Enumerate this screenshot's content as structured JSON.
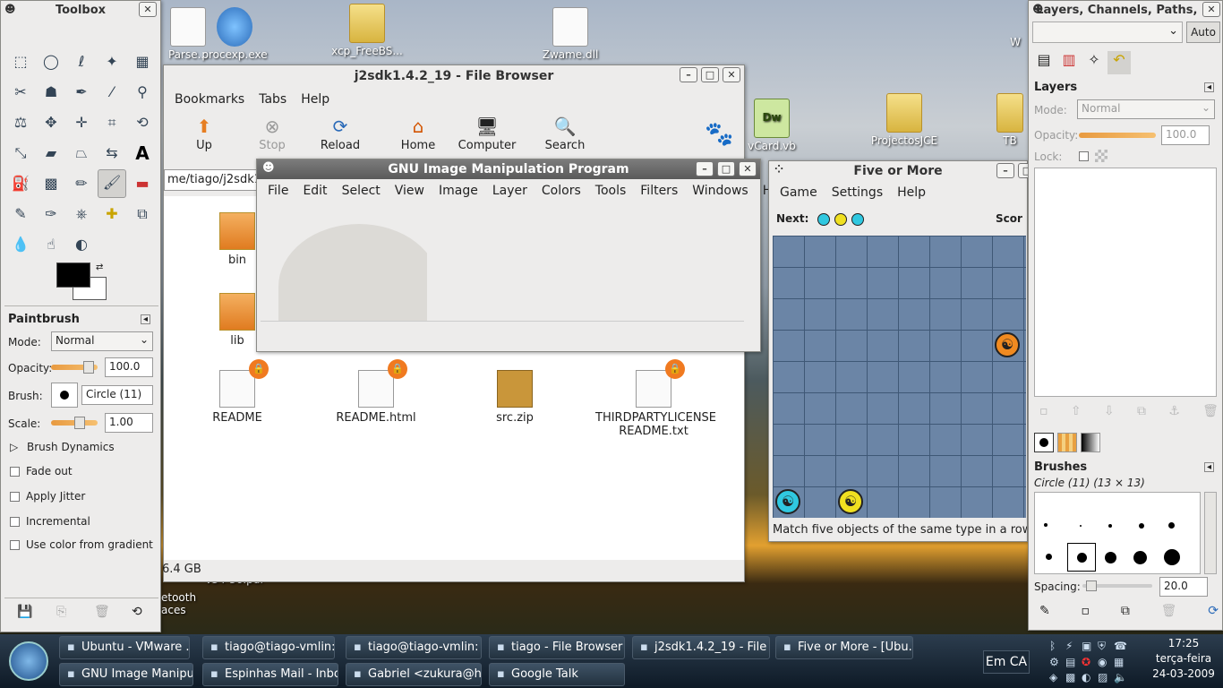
{
  "desktop": {
    "icons": [
      {
        "label": "Parse...",
        "kind": "file"
      },
      {
        "label": "procexp.exe",
        "kind": "app"
      },
      {
        "label": "xcp_FreeBS...",
        "kind": "folder"
      },
      {
        "label": "Zwame.dll",
        "kind": "file"
      },
      {
        "label": "vCard.vb",
        "kind": "dw"
      },
      {
        "label": "ProjectosJCE",
        "kind": "folder"
      },
      {
        "label": "TB",
        "kind": "folder"
      },
      {
        "label": "W",
        "kind": "file"
      },
      {
        "label": "v34-36.pdf",
        "kind": "file"
      },
      {
        "label": "etooth",
        "kind": "file"
      },
      {
        "label": "aces",
        "kind": "file"
      }
    ]
  },
  "toolbox": {
    "title": "Toolbox",
    "section": "Paintbrush",
    "mode_label": "Mode:",
    "mode_value": "Normal",
    "opacity_label": "Opacity:",
    "opacity_value": "100.0",
    "opacity": 1.0,
    "brush_label": "Brush:",
    "brush_value": "Circle (11)",
    "scale_label": "Scale:",
    "scale_value": "1.00",
    "dynamics": "Brush Dynamics",
    "options": [
      "Fade out",
      "Apply Jitter",
      "Incremental",
      "Use color from gradient"
    ]
  },
  "filebrowser": {
    "title": "j2sdk1.4.2_19 - File Browser",
    "menu": [
      "Bookmarks",
      "Tabs",
      "Help"
    ],
    "toolbar": [
      "Up",
      "Stop",
      "Reload",
      "Home",
      "Computer",
      "Search"
    ],
    "path": "me/tiago/j2sdk1.",
    "folders": [
      "bin",
      "lib"
    ],
    "files": [
      "README",
      "README.html",
      "src.zip",
      "THIRDPARTYLICENSE README.txt"
    ],
    "status": "6.4 GB"
  },
  "gimp": {
    "title": "GNU Image Manipulation Program",
    "menu": [
      "File",
      "Edit",
      "Select",
      "View",
      "Image",
      "Layer",
      "Colors",
      "Tools",
      "Filters",
      "Windows",
      "Help"
    ]
  },
  "fiveormore": {
    "title": "Five or More",
    "menu": [
      "Game",
      "Settings",
      "Help"
    ],
    "next_label": "Next:",
    "score_label": "Scor",
    "status": "Match five objects of the same type in a row"
  },
  "layers": {
    "title": "Layers, Channels, Paths, ...",
    "auto": "Auto",
    "section": "Layers",
    "mode_label": "Mode:",
    "mode_value": "Normal",
    "opacity_label": "Opacity:",
    "opacity_value": "100.0",
    "lock_label": "Lock:",
    "brushes_section": "Brushes",
    "brush_name": "Circle (11) (13 × 13)",
    "spacing_label": "Spacing:",
    "spacing_value": "20.0"
  },
  "taskbar": {
    "row1": [
      "Ubuntu - VMware ...",
      "tiago@tiago-vmlin: ...",
      "tiago@tiago-vmlin: ...",
      "tiago - File Browser ...",
      "j2sdk1.4.2_19 - File B...",
      "Five or More - [Ubu..."
    ],
    "row2": [
      "GNU Image Manipu...",
      "Espinhas Mail - Inbo...",
      "Gabriel <zukura@h...",
      "Google Talk"
    ],
    "lang": "Em CA",
    "time": "17:25",
    "day": "terça-feira",
    "date": "24-03-2009"
  }
}
